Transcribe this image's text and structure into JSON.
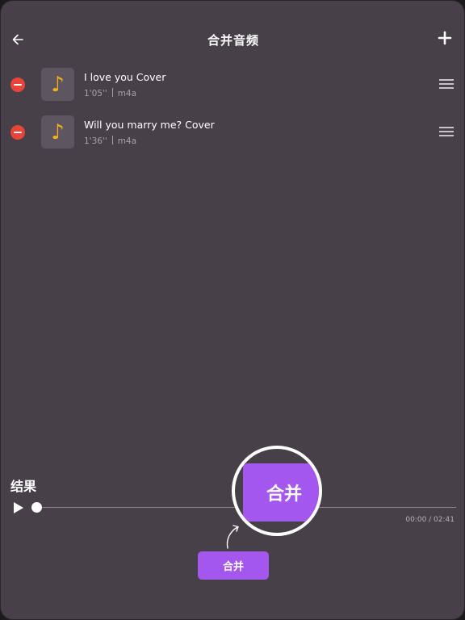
{
  "header": {
    "title": "合并音频",
    "back_icon": "back-arrow-icon",
    "add_icon": "plus-icon"
  },
  "tracks": [
    {
      "name": "I love you Cover",
      "duration": "1'05''",
      "format": "m4a"
    },
    {
      "name": "Will you marry me? Cover",
      "duration": "1'36''",
      "format": "m4a"
    }
  ],
  "result": {
    "label": "结果",
    "time": "00:00 / 02:41",
    "progress": 0
  },
  "merge_button": {
    "label": "合并"
  },
  "merge_zoom": {
    "label": "合并"
  },
  "colors": {
    "background": "#484049",
    "accent": "#a457ec",
    "remove": "#e8443a",
    "note": "#f3b21a"
  }
}
